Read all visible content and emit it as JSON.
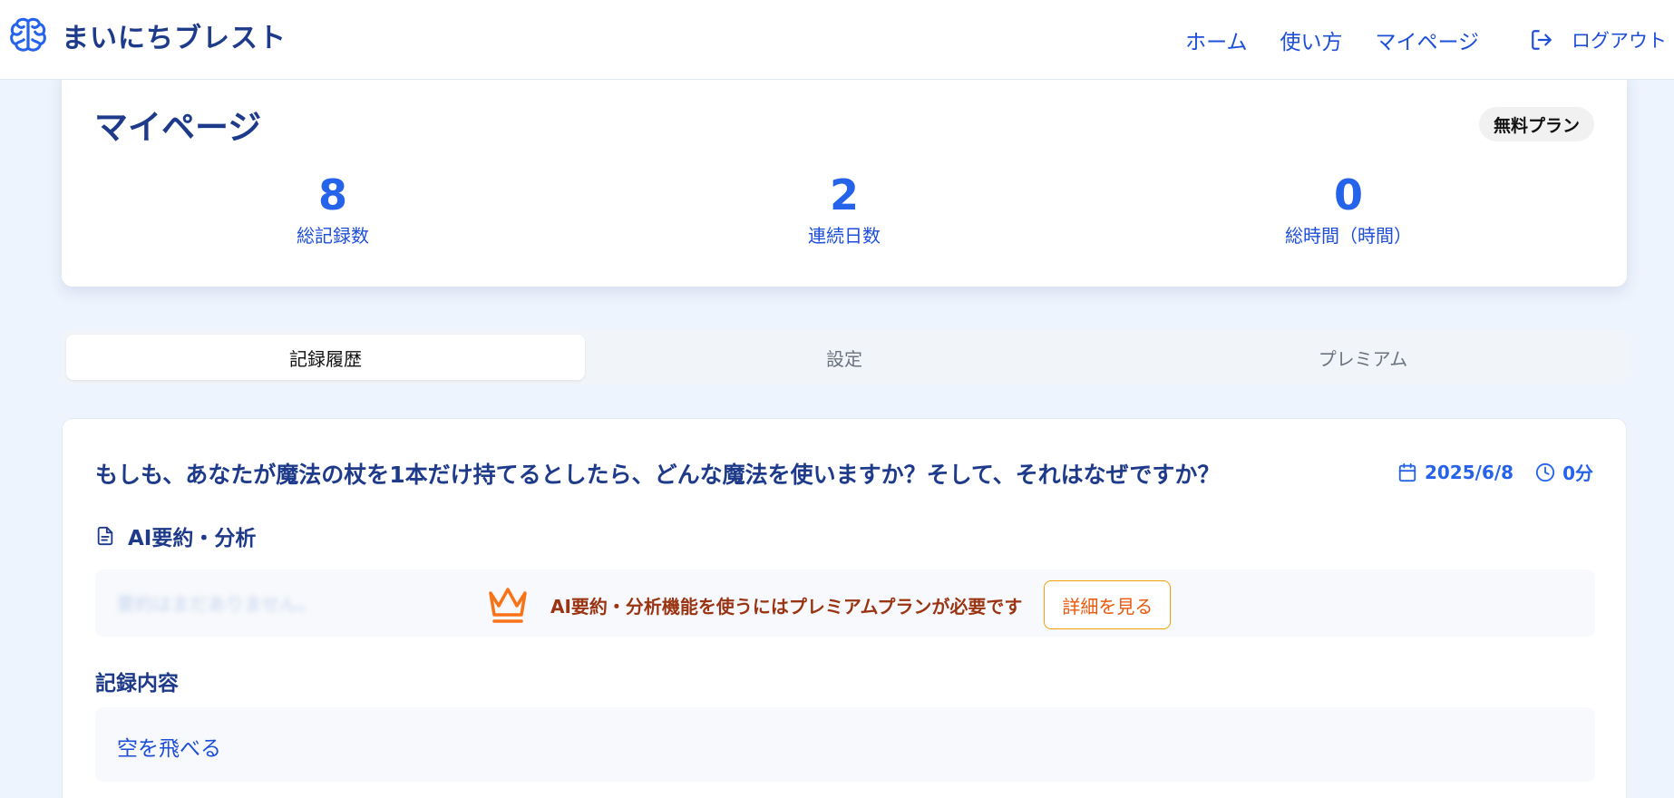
{
  "header": {
    "app_name": "まいにちブレスト",
    "nav": [
      "ホーム",
      "使い方",
      "マイページ"
    ],
    "logout_label": "ログアウト"
  },
  "profile": {
    "title": "マイページ",
    "plan_badge": "無料プラン",
    "stats": [
      {
        "value": "8",
        "label": "総記録数"
      },
      {
        "value": "2",
        "label": "連続日数"
      },
      {
        "value": "0",
        "label": "総時間（時間）"
      }
    ]
  },
  "tabs": [
    {
      "label": "記録履歴",
      "active": true
    },
    {
      "label": "設定",
      "active": false
    },
    {
      "label": "プレミアム",
      "active": false
    }
  ],
  "record": {
    "question": "もしも、あなたが魔法の杖を1本だけ持てるとしたら、どんな魔法を使いますか？そして、それはなぜですか？",
    "date": "2025/6/8",
    "duration": "0分",
    "ai_section_title": "AI要約・分析",
    "ai_blurred_text": "要約はまだありません。",
    "ai_locked_message": "AI要約・分析機能を使うにはプレミアムプランが必要です",
    "details_button": "詳細を見る",
    "content_section_title": "記録内容",
    "content_text": "空を飛べる"
  },
  "colors": {
    "primary": "#2563eb",
    "navy": "#1e3a8a",
    "premium_orange": "#ea580c",
    "background": "#eef4fd"
  }
}
